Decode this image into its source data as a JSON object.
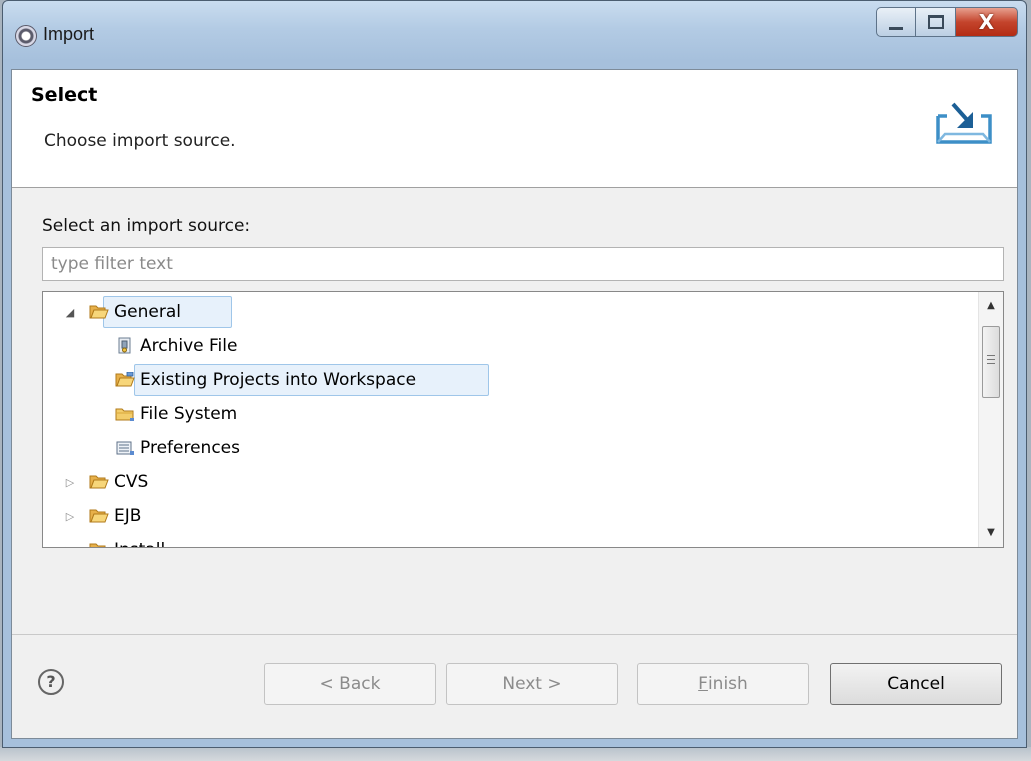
{
  "window": {
    "title": "Import"
  },
  "header": {
    "title": "Select",
    "description": "Choose import source."
  },
  "source": {
    "label": "Select an import source:",
    "filter_placeholder": "type filter text"
  },
  "tree": {
    "items": [
      {
        "label": "General",
        "expanded": true,
        "icon": "folder-open-icon"
      },
      {
        "label": "Archive File",
        "icon": "archive-file-icon"
      },
      {
        "label": "Existing Projects into Workspace",
        "icon": "project-folder-icon",
        "selected": true
      },
      {
        "label": "File System",
        "icon": "folder-icon"
      },
      {
        "label": "Preferences",
        "icon": "preferences-icon"
      },
      {
        "label": "CVS",
        "expanded": false,
        "icon": "folder-open-icon"
      },
      {
        "label": "EJB",
        "expanded": false,
        "icon": "folder-open-icon"
      },
      {
        "label": "Install",
        "expanded": false,
        "icon": "folder-open-icon"
      }
    ]
  },
  "buttons": {
    "back": "< Back",
    "next": "Next >",
    "finish_mnemonic": "F",
    "finish_rest": "inish",
    "cancel": "Cancel"
  }
}
